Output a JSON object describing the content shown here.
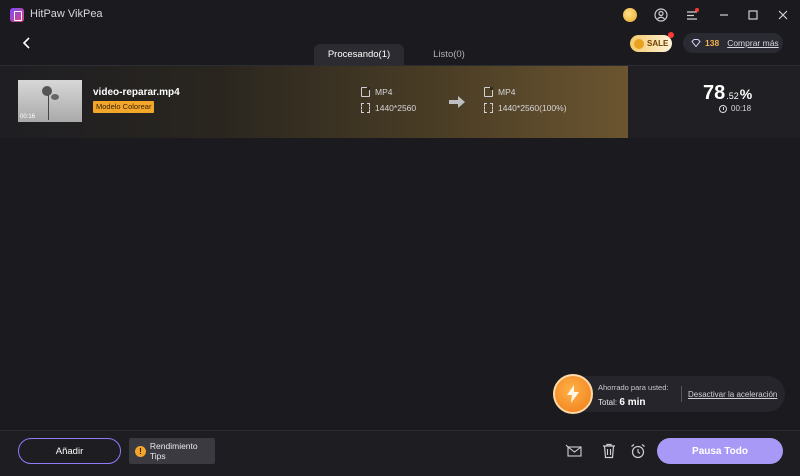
{
  "app": {
    "title": "HitPaw VikPea"
  },
  "header": {
    "tabs": [
      {
        "label": "Procesando(1)",
        "active": true
      },
      {
        "label": "Listo(0)",
        "active": false
      }
    ],
    "sale_label": "SALE",
    "credits": "138",
    "buy_more": "Comprar más"
  },
  "task": {
    "filename": "video-reparar.mp4",
    "thumb_duration": "00:16",
    "model_tag": "Modelo Colorear",
    "source": {
      "format": "MP4",
      "resolution": "1440*2560"
    },
    "output": {
      "format": "MP4",
      "resolution": "1440*2560(100%)"
    },
    "progress_int": "78",
    "progress_dec": ".52",
    "progress_sign": "%",
    "progress_fraction": 0.7852,
    "elapsed": "00:18"
  },
  "savings": {
    "label": "Ahorrado para usted:",
    "total_prefix": "Total:",
    "total_value": "6 min",
    "disable_link": "Desactivar la aceleración"
  },
  "footer": {
    "add_label": "Añadir",
    "tips_label": "Rendimiento Tips",
    "pause_all_label": "Pausa Todo"
  },
  "colors": {
    "accent": "#a999f7",
    "tag": "#f4a62a",
    "background": "#1b1b1f"
  }
}
